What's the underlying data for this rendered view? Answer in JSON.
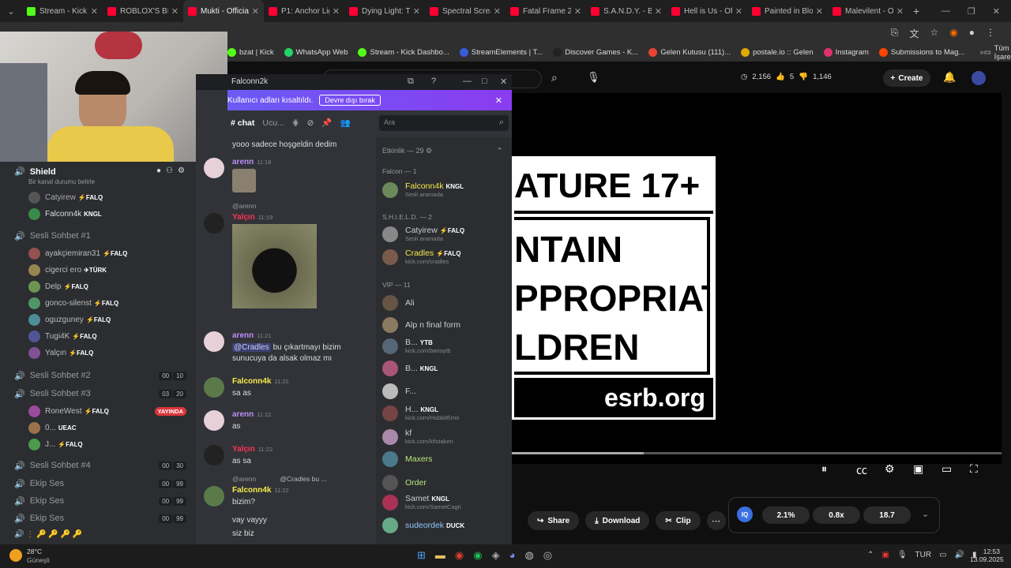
{
  "tabs": [
    {
      "label": "Stream - Kick D",
      "color": "#53fc18",
      "active": false
    },
    {
      "label": "ROBLOX'S BIGG",
      "color": "#ff0033",
      "active": false
    },
    {
      "label": "Mukti - Officia",
      "color": "#ff0033",
      "active": true
    },
    {
      "label": "P1: Anchor Lig",
      "color": "#ff0033",
      "active": false
    },
    {
      "label": "Dying Light: Th",
      "color": "#ff0033",
      "active": false
    },
    {
      "label": "Spectral Screa",
      "color": "#ff0033",
      "active": false
    },
    {
      "label": "Fatal Frame 2:",
      "color": "#ff0033",
      "active": false
    },
    {
      "label": "S.A.N.D.Y. - Ber",
      "color": "#ff0033",
      "active": false
    },
    {
      "label": "Hell is Us - Offi",
      "color": "#ff0033",
      "active": false
    },
    {
      "label": "Painted in Bloo",
      "color": "#ff0033",
      "active": false
    },
    {
      "label": "Malevilent - Of",
      "color": "#ff0033",
      "active": false
    }
  ],
  "bookmarks": [
    {
      "label": "bzat | Kick",
      "color": "#53fc18"
    },
    {
      "label": "WhatsApp Web",
      "color": "#25d366"
    },
    {
      "label": "Stream - Kick Dashbo...",
      "color": "#53fc18"
    },
    {
      "label": "StreamElements | T...",
      "color": "#3b5bdb"
    },
    {
      "label": "Discover Games - K...",
      "color": "#222"
    },
    {
      "label": "Gelen Kutusu (111)...",
      "color": "#ea4335"
    },
    {
      "label": "postale.io :: Gelen",
      "color": "#e0a800"
    },
    {
      "label": "Instagram",
      "color": "#e1306c"
    },
    {
      "label": "Submissions to Mag...",
      "color": "#ff4500"
    }
  ],
  "bookmarks_all": "Tüm Yer İşaretleri",
  "yt": {
    "views": "2,156",
    "likes": "5",
    "dislikes": "1,146",
    "create": "Create",
    "esrb_title": "ATURE 17+",
    "esrb_lines": [
      "NTAIN",
      "PPROPRIATE",
      "LDREN"
    ],
    "esrb_url": "esrb.org",
    "share": "Share",
    "download": "Download",
    "clip": "Clip",
    "iq": "IQ",
    "pct": "2.1%",
    "speed": "0.8x",
    "num": "18.7"
  },
  "discord": {
    "server": "Shield",
    "status_hint": "Bir kanal durumu belirle",
    "top_users": [
      {
        "name": "Catyirew",
        "role": "⚡FALQ",
        "color": "#aaa"
      },
      {
        "name": "Falconn4k",
        "role": "KNGL",
        "color": "#ddd"
      }
    ],
    "vc1": "Sesli Sohbet #1",
    "vc1_users": [
      {
        "name": "ayakçiemiran31",
        "role": "⚡FALQ"
      },
      {
        "name": "cigerci ero",
        "role": "✈TÜRK"
      },
      {
        "name": "Delp",
        "role": "⚡FALQ"
      },
      {
        "name": "gonco-silenst",
        "role": "⚡FALQ"
      },
      {
        "name": "oguzguney",
        "role": "⚡FALQ"
      },
      {
        "name": "Tugi4K",
        "role": "⚡FALQ"
      },
      {
        "name": "Yalçın",
        "role": "⚡FALQ"
      }
    ],
    "vc2": "Sesli Sohbet #2",
    "vc2_a": "00",
    "vc2_b": "10",
    "vc3": "Sesli Sohbet #3",
    "vc3_a": "03",
    "vc3_b": "20",
    "vc3_users": [
      {
        "name": "RoneWest",
        "role": "⚡FALQ",
        "live": "YAYINDA"
      },
      {
        "name": "0...",
        "role": "UEAC",
        "live": ""
      },
      {
        "name": "J...",
        "role": "⚡FALQ",
        "live": ""
      }
    ],
    "vc4": "Sesli Sohbet #4",
    "vc4_a": "00",
    "vc4_b": "30",
    "ekip": [
      {
        "name": "Ekip Ses",
        "a": "00",
        "b": "99"
      },
      {
        "name": "Ekip Ses",
        "a": "00",
        "b": "99"
      },
      {
        "name": "Ekip Ses",
        "a": "00",
        "b": "99"
      }
    ]
  },
  "chat": {
    "title": "Falconn2k",
    "banner": "Kullanıcı adları kısaltıldı.",
    "banner_btn": "Devre dışı bırak",
    "tab_chat": "chat",
    "tab_ucu": "Ucu...",
    "search_placeholder": "Ara",
    "first_line": "yooo sadece hoşgeldin dedim",
    "messages": [
      {
        "user": "arenn",
        "time": "11:18",
        "text": "",
        "color": "#b98ef5"
      },
      {
        "reply": "@arenn",
        "user": "Yalçın",
        "time": "11:19",
        "text": "",
        "color": "#ff3355"
      },
      {
        "user": "arenn",
        "time": "11:21",
        "text": "bu çıkartmayı bizim sunucuya da alsak olmaz mı",
        "mention": "@Cradles",
        "color": "#b98ef5"
      },
      {
        "user": "Falconn4k",
        "time": "11:22",
        "text": "sa as",
        "color": "#f5e94a"
      },
      {
        "user": "arenn",
        "time": "11:22",
        "text": "as",
        "color": "#b98ef5"
      },
      {
        "user": "Yalçın",
        "time": "11:22",
        "text": "as sa",
        "color": "#ff3355"
      },
      {
        "reply": "@arenn",
        "reply2": "@Cradles bu ...",
        "user": "Falconn4k",
        "time": "11:22",
        "text": "bizim?",
        "color": "#f5e94a"
      }
    ],
    "extra_lines": [
      "vay vayyy",
      "siz biz"
    ],
    "activity": "Etkinlik — 29",
    "groups": [
      {
        "title": "Falcon — 1"
      },
      {
        "title": "S.H.I.E.L.D. — 2"
      },
      {
        "title": "VİP — 11"
      }
    ],
    "members": [
      {
        "name": "Falconn4k",
        "tag": "KNGL",
        "sub": "Sesli aramada",
        "color": "#f5e94a"
      },
      {
        "name": "Catyirew",
        "tag": "⚡FALQ",
        "sub": "Sesli aramada",
        "color": "#ccc"
      },
      {
        "name": "Cradles",
        "tag": "⚡FALQ",
        "sub": "kick.com/cradles",
        "color": "#f5e94a"
      },
      {
        "name": "Ali",
        "tag": "",
        "sub": "",
        "color": "#ccc"
      },
      {
        "name": "Alp n final form",
        "tag": "",
        "sub": "",
        "color": "#ccc"
      },
      {
        "name": "B...",
        "tag": "YTB",
        "sub": "kick.com/barisytb",
        "color": "#ccc"
      },
      {
        "name": "B...",
        "tag": "KNGL",
        "sub": "",
        "color": "#ccc"
      },
      {
        "name": "F...",
        "tag": "",
        "sub": "",
        "color": "#ccc"
      },
      {
        "name": "H...",
        "tag": "KNGL",
        "sub": "kick.com/HobbitEmo",
        "color": "#ccc"
      },
      {
        "name": "kf",
        "tag": "",
        "sub": "kick.com/kfistaken",
        "color": "#ccc"
      },
      {
        "name": "Maxers",
        "tag": "",
        "sub": "",
        "color": "#b8e87a"
      },
      {
        "name": "Order",
        "tag": "",
        "sub": "",
        "color": "#b8e87a"
      },
      {
        "name": "Samet",
        "tag": "KNGL",
        "sub": "kick.com/SametCagri",
        "color": "#ccc"
      },
      {
        "name": "sudeordek",
        "tag": "DUCK",
        "sub": "",
        "color": "#8ec7ff"
      }
    ]
  },
  "taskbar": {
    "temp": "28°C",
    "weather": "Güneşli",
    "lang": "TUR",
    "time": "12:53",
    "date": "13.09.2025"
  }
}
